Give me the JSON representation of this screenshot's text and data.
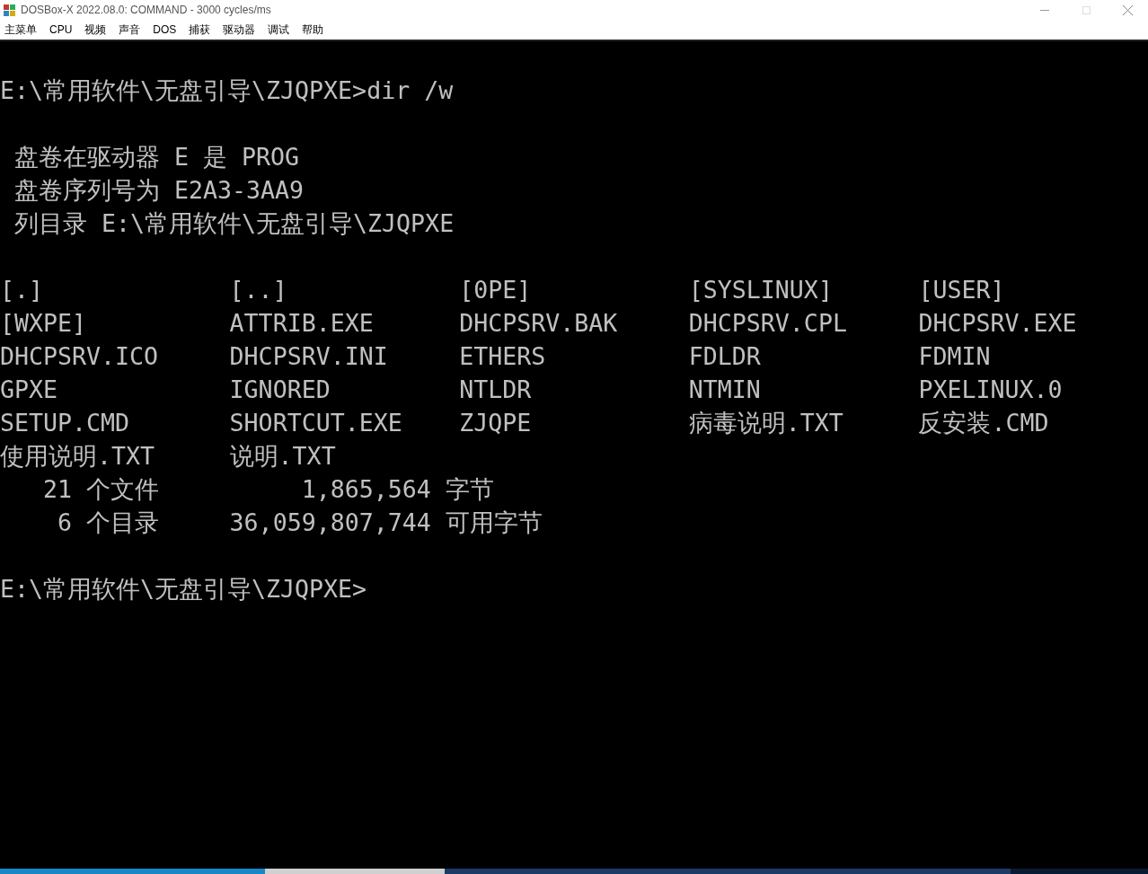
{
  "window": {
    "title": "DOSBox-X 2022.08.0: COMMAND - 3000 cycles/ms"
  },
  "menu": [
    "主菜单",
    "CPU",
    "视频",
    "声音",
    "DOS",
    "捕获",
    "驱动器",
    "调试",
    "帮助"
  ],
  "terminal": {
    "blocks": [
      {
        "kind": "lines",
        "lines": [
          "E:\\常用软件\\无盘引导\\ZJQPXE>dir /w"
        ]
      },
      {
        "kind": "lines",
        "lines": [
          " 盘卷在驱动器 E 是 PROG",
          " 盘卷序列号为 E2A3-3AA9",
          " 列目录 E:\\常用软件\\无盘引导\\ZJQPXE"
        ]
      },
      {
        "kind": "grid",
        "rows": [
          [
            "[.]",
            "[..]",
            "[0PE]",
            "[SYSLINUX]",
            "[USER]"
          ],
          [
            "[WXPE]",
            "ATTRIB.EXE",
            "DHCPSRV.BAK",
            "DHCPSRV.CPL",
            "DHCPSRV.EXE"
          ],
          [
            "DHCPSRV.ICO",
            "DHCPSRV.INI",
            "ETHERS",
            "FDLDR",
            "FDMIN"
          ],
          [
            "GPXE",
            "IGNORED",
            "NTLDR",
            "NTMIN",
            "PXELINUX.0"
          ],
          [
            "SETUP.CMD",
            "SHORTCUT.EXE",
            "ZJQPE",
            "病毒说明.TXT",
            "反安装.CMD"
          ],
          [
            "使用说明.TXT",
            "说明.TXT"
          ],
          [
            "   21 个文件",
            "     1,865,564 字节"
          ],
          [
            "    6 个目录",
            "36,059,807,744 可用字节"
          ]
        ]
      },
      {
        "kind": "lines",
        "lines": [
          "E:\\常用软件\\无盘引导\\ZJQPXE>"
        ]
      }
    ]
  }
}
